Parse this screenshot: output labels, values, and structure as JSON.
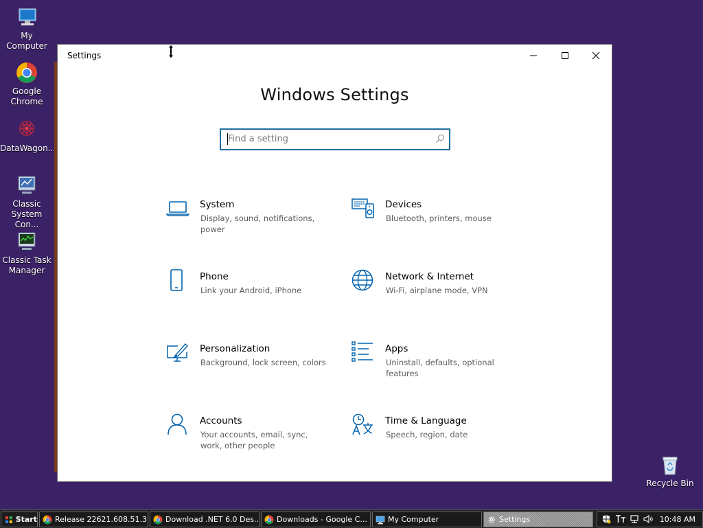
{
  "desktop": {
    "icons": [
      {
        "label": "My Computer",
        "icon": "computer-icon"
      },
      {
        "label": "Google Chrome",
        "icon": "chrome-icon"
      },
      {
        "label": "DataWagon...",
        "icon": "datawagon-icon"
      },
      {
        "label": "Classic System Con...",
        "icon": "control-panel-icon"
      },
      {
        "label": "Classic Task Manager",
        "icon": "task-manager-icon"
      }
    ],
    "recycle_bin": {
      "label": "Recycle Bin",
      "icon": "recycle-bin-icon"
    }
  },
  "window": {
    "title": "Settings",
    "heading": "Windows Settings",
    "search": {
      "placeholder": "Find a setting"
    },
    "tiles": [
      {
        "name": "System",
        "desc": "Display, sound, notifications, power",
        "icon": "laptop-icon"
      },
      {
        "name": "Devices",
        "desc": "Bluetooth, printers, mouse",
        "icon": "devices-icon"
      },
      {
        "name": "Phone",
        "desc": "Link your Android, iPhone",
        "icon": "phone-icon"
      },
      {
        "name": "Network & Internet",
        "desc": "Wi-Fi, airplane mode, VPN",
        "icon": "globe-icon"
      },
      {
        "name": "Personalization",
        "desc": "Background, lock screen, colors",
        "icon": "personalization-icon"
      },
      {
        "name": "Apps",
        "desc": "Uninstall, defaults, optional features",
        "icon": "apps-list-icon"
      },
      {
        "name": "Accounts",
        "desc": "Your accounts, email, sync, work, other people",
        "icon": "person-icon"
      },
      {
        "name": "Time & Language",
        "desc": "Speech, region, date",
        "icon": "time-language-icon"
      }
    ]
  },
  "taskbar": {
    "start_label": "Start",
    "buttons": [
      {
        "label": "Release 22621.608.51.3...",
        "icon": "chrome-icon"
      },
      {
        "label": "Download .NET 6.0 Des...",
        "icon": "chrome-icon"
      },
      {
        "label": "Downloads - Google C...",
        "icon": "chrome-icon"
      },
      {
        "label": "My Computer",
        "icon": "computer-icon"
      },
      {
        "label": "Settings",
        "icon": "gear-icon"
      }
    ],
    "clock": "10:48 AM"
  },
  "colors": {
    "desktop_bg": "#3b2166",
    "accent": "#0063b1",
    "search_border": "#1f6e9e"
  }
}
